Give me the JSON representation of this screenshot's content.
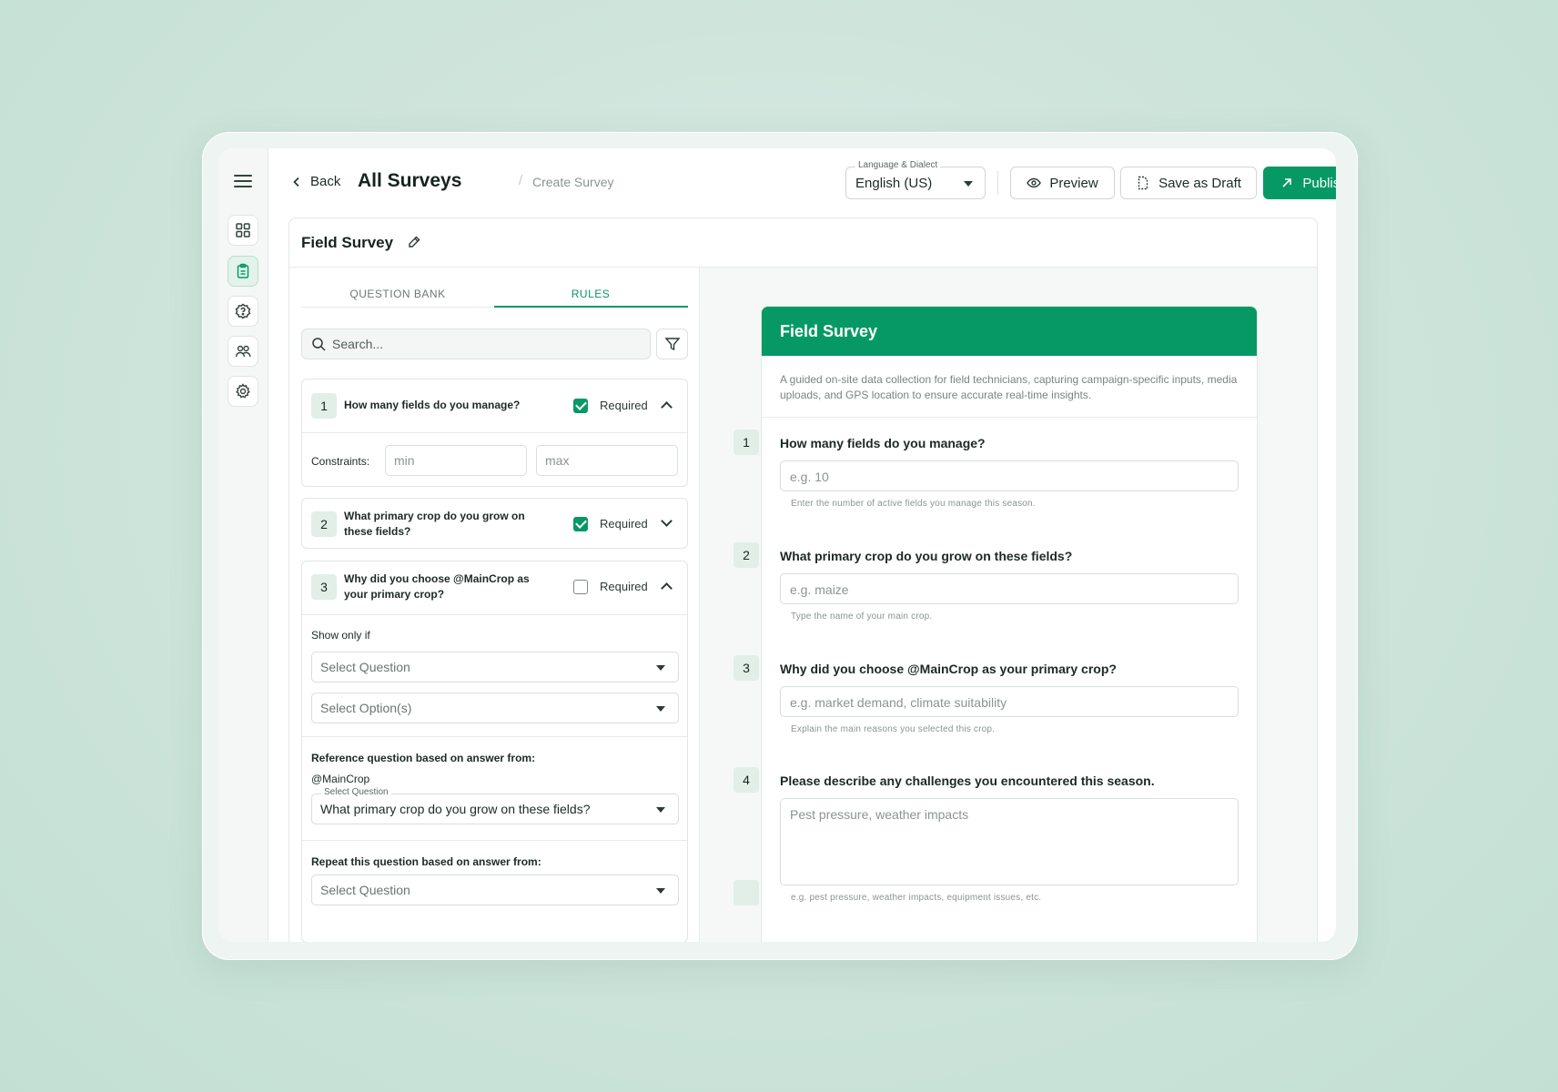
{
  "header": {
    "back_label": "Back",
    "title": "All Surveys",
    "breadcrumb": "Create Survey",
    "language": {
      "legend": "Language & Dialect",
      "value": "English (US)"
    },
    "preview_label": "Preview",
    "draft_label": "Save as Draft",
    "publish_label": "Publish"
  },
  "survey": {
    "title": "Field Survey"
  },
  "builder": {
    "tabs": [
      "QUESTION BANK",
      "RULES"
    ],
    "active_tab": "RULES",
    "search_placeholder": "Search...",
    "required_label": "Required",
    "questions": [
      {
        "number": "1",
        "text": "How many fields do you manage?",
        "required": true,
        "constraints": {
          "label": "Constraints:",
          "min_placeholder": "min",
          "max_placeholder": "max"
        }
      },
      {
        "number": "2",
        "text": "What primary crop do you grow on these fields?",
        "required": true
      },
      {
        "number": "3",
        "text": "Why did you choose @MainCrop as your primary crop?",
        "required": false,
        "show_only_if": {
          "label": "Show only if",
          "question_placeholder": "Select Question",
          "options_placeholder": "Select Option(s)"
        },
        "reference": {
          "label": "Reference question based on answer from:",
          "tag": "@MainCrop",
          "legend": "Select Question",
          "value": "What primary crop do you grow on these fields?"
        },
        "repeat": {
          "label": "Repeat this question based on answer from:",
          "placeholder": "Select Question"
        }
      }
    ]
  },
  "preview": {
    "title": "Field Survey",
    "description": "A guided on-site data collection for field technicians, capturing campaign-specific inputs, media uploads, and GPS location to ensure accurate real-time insights.",
    "questions": [
      {
        "number": "1",
        "text": "How many fields do you manage?",
        "placeholder": "e.g. 10",
        "help": "Enter the number of active fields you manage this season."
      },
      {
        "number": "2",
        "text": "What primary crop do you grow on these fields?",
        "placeholder": "e.g. maize",
        "help": "Type the name of your main crop."
      },
      {
        "number": "3",
        "text": "Why did you choose @MainCrop as your primary crop?",
        "placeholder": "e.g. market demand, climate suitability",
        "help": "Explain the main reasons you selected this crop."
      },
      {
        "number": "4",
        "text": "Please describe any challenges you encountered this season.",
        "placeholder": "Pest pressure, weather impacts",
        "help": "e.g. pest pressure, weather impacts, equipment issues, etc."
      }
    ]
  },
  "colors": {
    "accent": "#079965",
    "badge": "#e1efe8"
  },
  "icons": [
    "menu-icon",
    "dashboard-icon",
    "clipboard-icon",
    "help-icon",
    "users-icon",
    "gear-icon",
    "chevron-left-icon",
    "caret-down-icon",
    "eye-icon",
    "draft-icon",
    "arrow-up-right-icon",
    "pencil-icon",
    "search-icon",
    "filter-icon"
  ]
}
